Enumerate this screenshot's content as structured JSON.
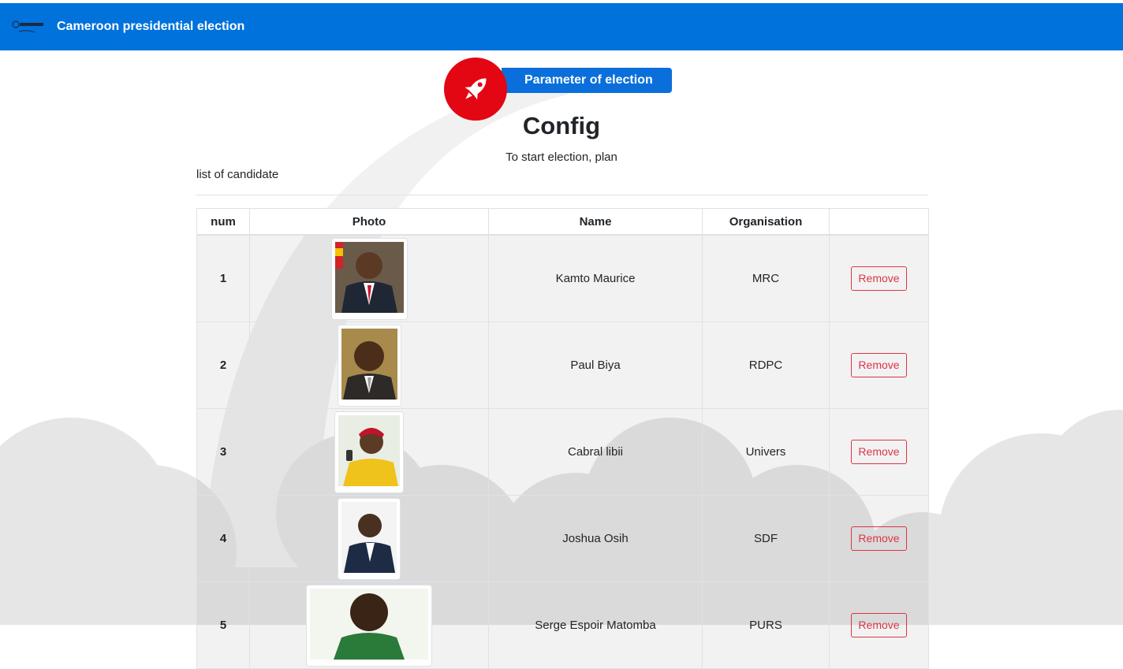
{
  "header": {
    "title": "Cameroon presidential election",
    "logo_icon": "suprimo-logo"
  },
  "hero": {
    "badge_label": "Parameter of election",
    "icon": "rocket-icon",
    "title": "Config",
    "subtitle": "To start election, plan"
  },
  "candidates": {
    "heading": "list of candidate",
    "columns": [
      "num",
      "Photo",
      "Name",
      "Organisation",
      ""
    ],
    "rows": [
      {
        "num": "1",
        "name": "Kamto Maurice",
        "organisation": "MRC",
        "action": "Remove"
      },
      {
        "num": "2",
        "name": "Paul Biya",
        "organisation": "RDPC",
        "action": "Remove"
      },
      {
        "num": "3",
        "name": "Cabral libii",
        "organisation": "Univers",
        "action": "Remove"
      },
      {
        "num": "4",
        "name": "Joshua Osih",
        "organisation": "SDF",
        "action": "Remove"
      },
      {
        "num": "5",
        "name": "Serge Espoir Matomba",
        "organisation": "PURS",
        "action": "Remove"
      }
    ]
  },
  "colors": {
    "header_bg": "#0072db",
    "badge_bg": "#0a6fdb",
    "rocket_bg": "#e30613",
    "danger": "#dc3545"
  }
}
